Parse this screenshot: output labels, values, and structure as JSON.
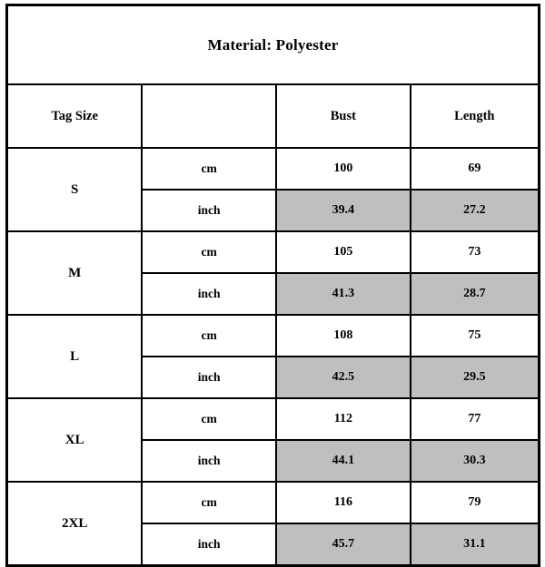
{
  "chart_data": {
    "type": "table",
    "title": "Material: Polyester",
    "columns": [
      "Tag Size",
      "",
      "Bust",
      "Length"
    ],
    "units": [
      "cm",
      "inch"
    ],
    "shaded_unit": "inch",
    "shaded_color": "#bfbfbf",
    "border_color": "#000000",
    "background_color": "#ffffff",
    "rows": [
      {
        "size": "S",
        "measurements": [
          {
            "unit": "cm",
            "bust": "100",
            "length": "69",
            "shaded": false
          },
          {
            "unit": "inch",
            "bust": "39.4",
            "length": "27.2",
            "shaded": true
          }
        ]
      },
      {
        "size": "M",
        "measurements": [
          {
            "unit": "cm",
            "bust": "105",
            "length": "73",
            "shaded": false
          },
          {
            "unit": "inch",
            "bust": "41.3",
            "length": "28.7",
            "shaded": true
          }
        ]
      },
      {
        "size": "L",
        "measurements": [
          {
            "unit": "cm",
            "bust": "108",
            "length": "75",
            "shaded": false
          },
          {
            "unit": "inch",
            "bust": "42.5",
            "length": "29.5",
            "shaded": true
          }
        ]
      },
      {
        "size": "XL",
        "measurements": [
          {
            "unit": "cm",
            "bust": "112",
            "length": "77",
            "shaded": false
          },
          {
            "unit": "inch",
            "bust": "44.1",
            "length": "30.3",
            "shaded": true
          }
        ]
      },
      {
        "size": "2XL",
        "measurements": [
          {
            "unit": "cm",
            "bust": "116",
            "length": "79",
            "shaded": false
          },
          {
            "unit": "inch",
            "bust": "45.7",
            "length": "31.1",
            "shaded": true
          }
        ]
      }
    ]
  }
}
